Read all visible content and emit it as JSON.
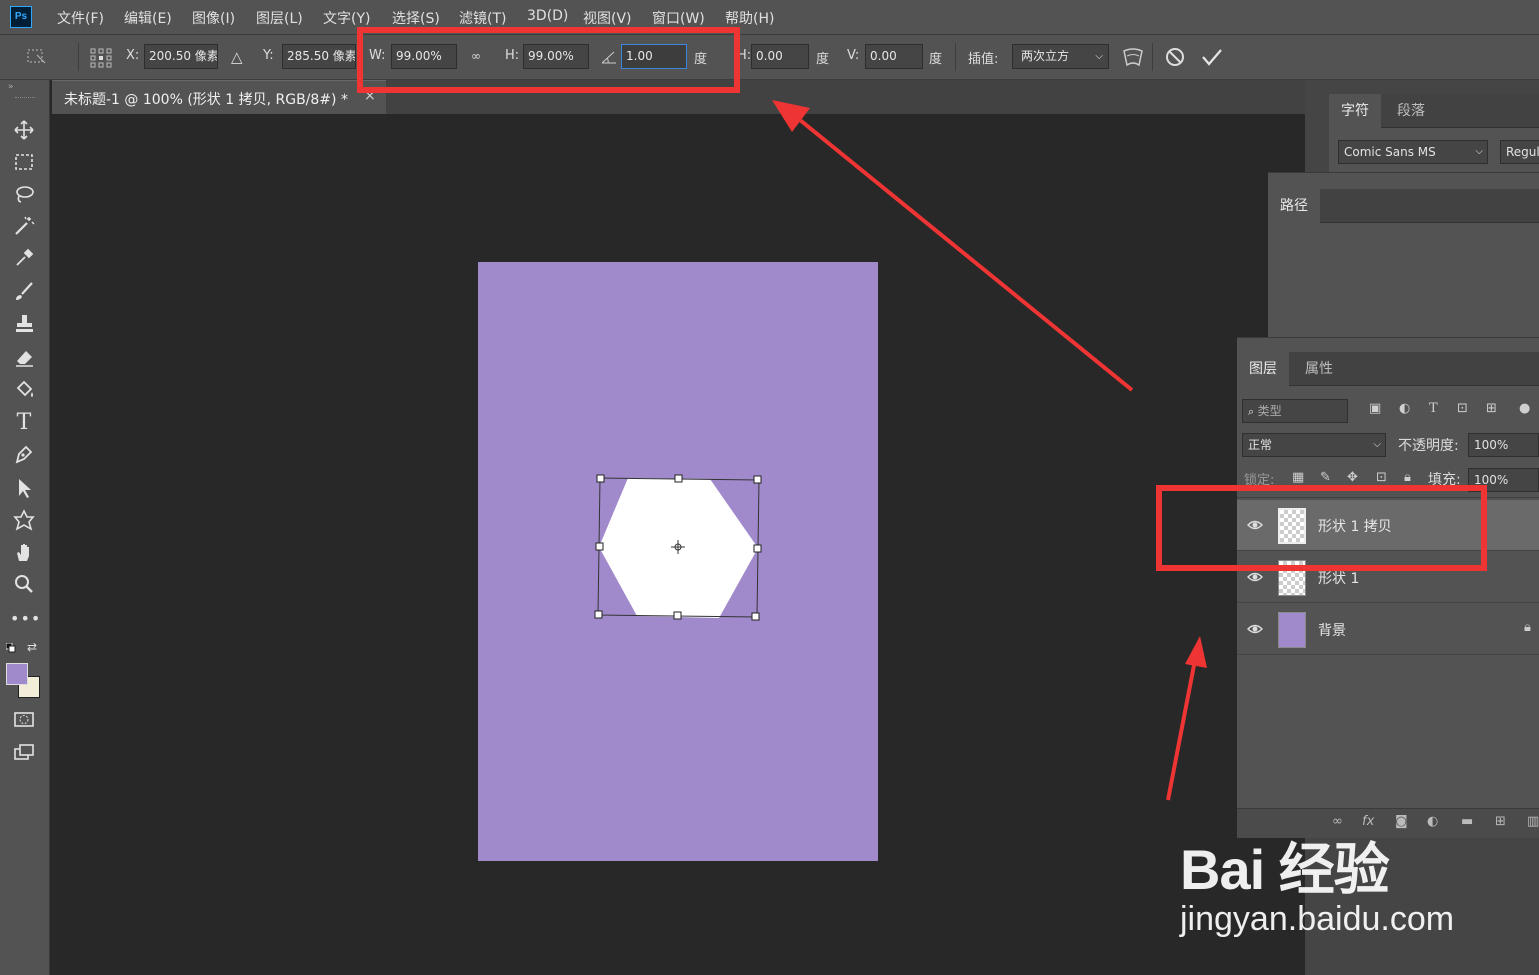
{
  "app": {
    "logo": "Ps"
  },
  "menu": [
    "文件(F)",
    "编辑(E)",
    "图像(I)",
    "图层(L)",
    "文字(Y)",
    "选择(S)",
    "滤镜(T)",
    "3D(D)",
    "视图(V)",
    "窗口(W)",
    "帮助(H)"
  ],
  "options": {
    "x_label": "X:",
    "x_value": "200.50 像素",
    "delta_label": "△",
    "y_label": "Y:",
    "y_value": "285.50 像素",
    "w_label": "W:",
    "w_value": "99.00%",
    "link_icon": "∞",
    "h_label": "H:",
    "h_value": "99.00%",
    "angle_value": "1.00",
    "angle_unit": "度",
    "hskew_label": "H:",
    "hskew_value": "0.00",
    "hskew_unit": "度",
    "vskew_label": "V:",
    "vskew_value": "0.00",
    "vskew_unit": "度",
    "interp_label": "插值:",
    "interp_value": "两次立方"
  },
  "document": {
    "tab_title": "未标题-1 @ 100% (形状 1 拷贝, RGB/8#) *",
    "close": "×"
  },
  "colors": {
    "canvas": "#a08acb",
    "foreground": "#a08acb",
    "background": "#f2edd9",
    "highlight": "#ef3434"
  },
  "character_panel": {
    "tabs": [
      "字符",
      "段落"
    ],
    "font_family": "Comic Sans MS",
    "font_style": "Regular"
  },
  "paths_panel": {
    "tab": "路径"
  },
  "layers_panel": {
    "tabs": [
      "图层",
      "属性"
    ],
    "filter_placeholder": "类型",
    "blend_mode": "正常",
    "opacity_label": "不透明度:",
    "opacity_value": "100%",
    "lock_label": "锁定:",
    "fill_label": "填充:",
    "fill_value": "100%",
    "layers": [
      {
        "name": "形状 1 拷贝",
        "selected": true
      },
      {
        "name": "形状 1",
        "selected": false
      },
      {
        "name": "背景",
        "selected": false
      }
    ],
    "footer_fx": "fx"
  },
  "watermark": {
    "brand": "Bai 经验",
    "url": "jingyan.baidu.com"
  }
}
